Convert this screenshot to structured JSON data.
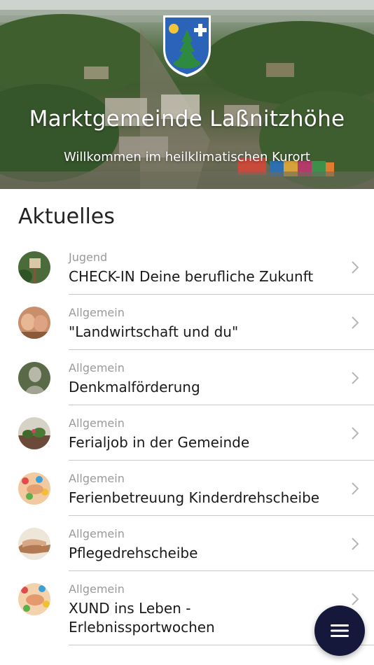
{
  "header": {
    "title": "Marktgemeinde Laßnitzhöhe",
    "subtitle": "Willkommen im heilklimatischen Kurort",
    "crest_icon": "municipal-coat-of-arms"
  },
  "news": {
    "section_title": "Aktuelles",
    "items": [
      {
        "category": "Jugend",
        "title": "CHECK-IN Deine berufliche Zukunft",
        "thumb_color": "#4b6b3a"
      },
      {
        "category": "Allgemein",
        "title": "\"Landwirtschaft und du\"",
        "thumb_color": "#c98f6a"
      },
      {
        "category": "Allgemein",
        "title": "Denkmalförderung",
        "thumb_color": "#6f7a5b"
      },
      {
        "category": "Allgemein",
        "title": "Ferialjob in der Gemeinde",
        "thumb_color": "#7a5a4a"
      },
      {
        "category": "Allgemein",
        "title": "Ferienbetreuung Kinderdrehscheibe",
        "thumb_color": "#e3a070"
      },
      {
        "category": "Allgemein",
        "title": "Pflegedrehscheibe",
        "thumb_color": "#b27a52"
      },
      {
        "category": "Allgemein",
        "title": "XUND ins Leben -\nErlebnissportwochen",
        "thumb_color": "#e49a6c"
      }
    ]
  },
  "menu": {
    "icon": "hamburger-menu-icon",
    "color": "#15173b"
  }
}
